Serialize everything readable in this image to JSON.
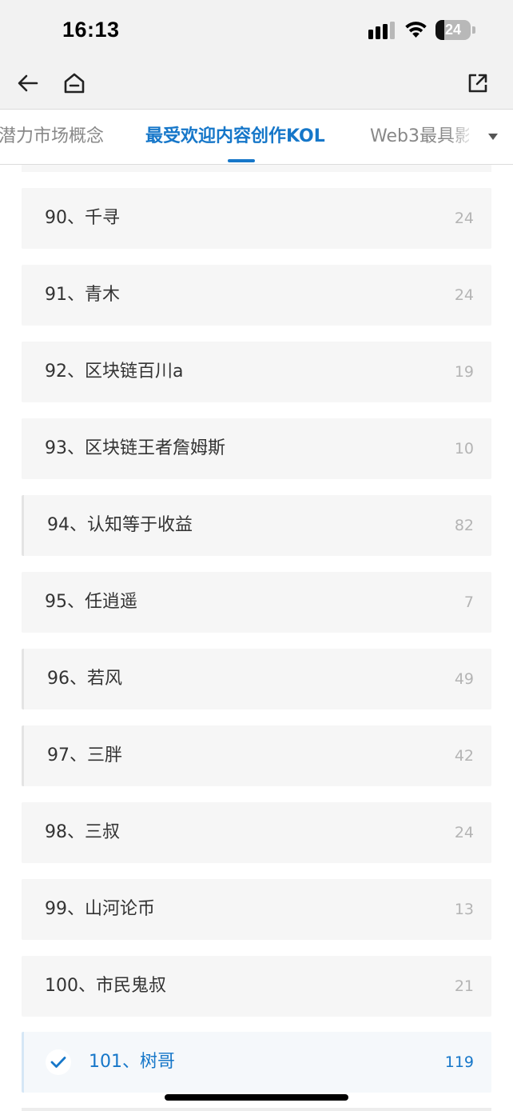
{
  "status_bar": {
    "time": "16:13",
    "battery_level": "24",
    "battery_fraction": 0.24
  },
  "nav": {
    "icons": [
      "back-arrow-icon",
      "home-icon",
      "share-icon"
    ]
  },
  "tabs": [
    {
      "label": "潜力市场概念",
      "active": false
    },
    {
      "label": "最受欢迎内容创作KOL",
      "active": true
    },
    {
      "label": "Web3最具影",
      "active": false
    }
  ],
  "colors": {
    "accent": "#1677c9",
    "item_background": "#f6f6f6",
    "count_text": "#b4b4b4"
  },
  "list": {
    "items": [
      {
        "label": "90、千寻",
        "count": "24",
        "marked": false,
        "selected": false
      },
      {
        "label": "91、青木",
        "count": "24",
        "marked": false,
        "selected": false
      },
      {
        "label": "92、区块链百川a",
        "count": "19",
        "marked": false,
        "selected": false
      },
      {
        "label": "93、区块链王者詹姆斯",
        "count": "10",
        "marked": false,
        "selected": false
      },
      {
        "label": "94、认知等于收益",
        "count": "82",
        "marked": true,
        "selected": false
      },
      {
        "label": "95、任逍遥",
        "count": "7",
        "marked": false,
        "selected": false
      },
      {
        "label": "96、若风",
        "count": "49",
        "marked": true,
        "selected": false
      },
      {
        "label": "97、三胖",
        "count": "42",
        "marked": true,
        "selected": false
      },
      {
        "label": "98、三叔",
        "count": "24",
        "marked": false,
        "selected": false
      },
      {
        "label": "99、山河论币",
        "count": "13",
        "marked": false,
        "selected": false
      },
      {
        "label": "100、市民鬼叔",
        "count": "21",
        "marked": false,
        "selected": false
      },
      {
        "label": "101、树哥",
        "count": "119",
        "marked": false,
        "selected": true
      }
    ]
  }
}
